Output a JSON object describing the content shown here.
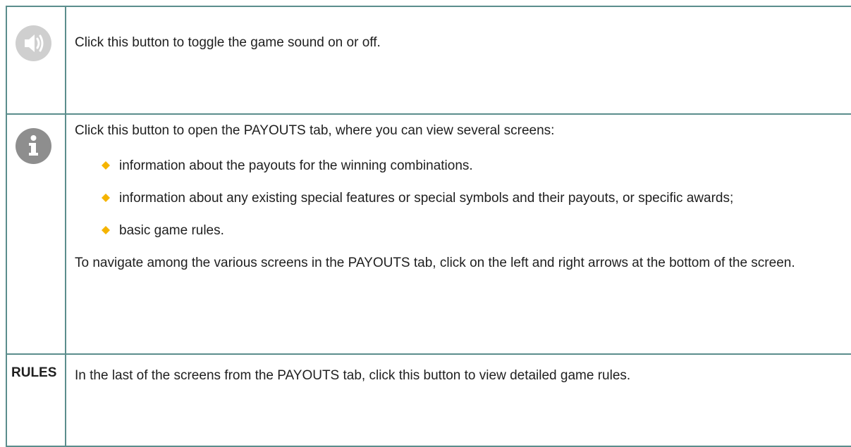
{
  "rows": {
    "sound": {
      "icon": "speaker-icon",
      "text": "Click this button to toggle the game sound on or off."
    },
    "info": {
      "icon": "info-icon",
      "intro": "Click this button to open the PAYOUTS tab, where you can view several screens:",
      "bullets": [
        "information about the payouts for the winning combinations.",
        "information about any existing special features or special symbols and their payouts, or specific awards;",
        "basic game rules."
      ],
      "navigation": "To navigate among the various screens in the PAYOUTS tab, click on the left and right arrows at the bottom of the screen."
    },
    "rules": {
      "label": "RULES",
      "text": "In the last of the screens from the PAYOUTS tab, click this button to view detailed game rules."
    }
  },
  "colors": {
    "border": "#5b8d8c",
    "bullet": "#f5b400",
    "sound_icon": "#cfcfcf",
    "info_icon": "#8e8e8e"
  }
}
